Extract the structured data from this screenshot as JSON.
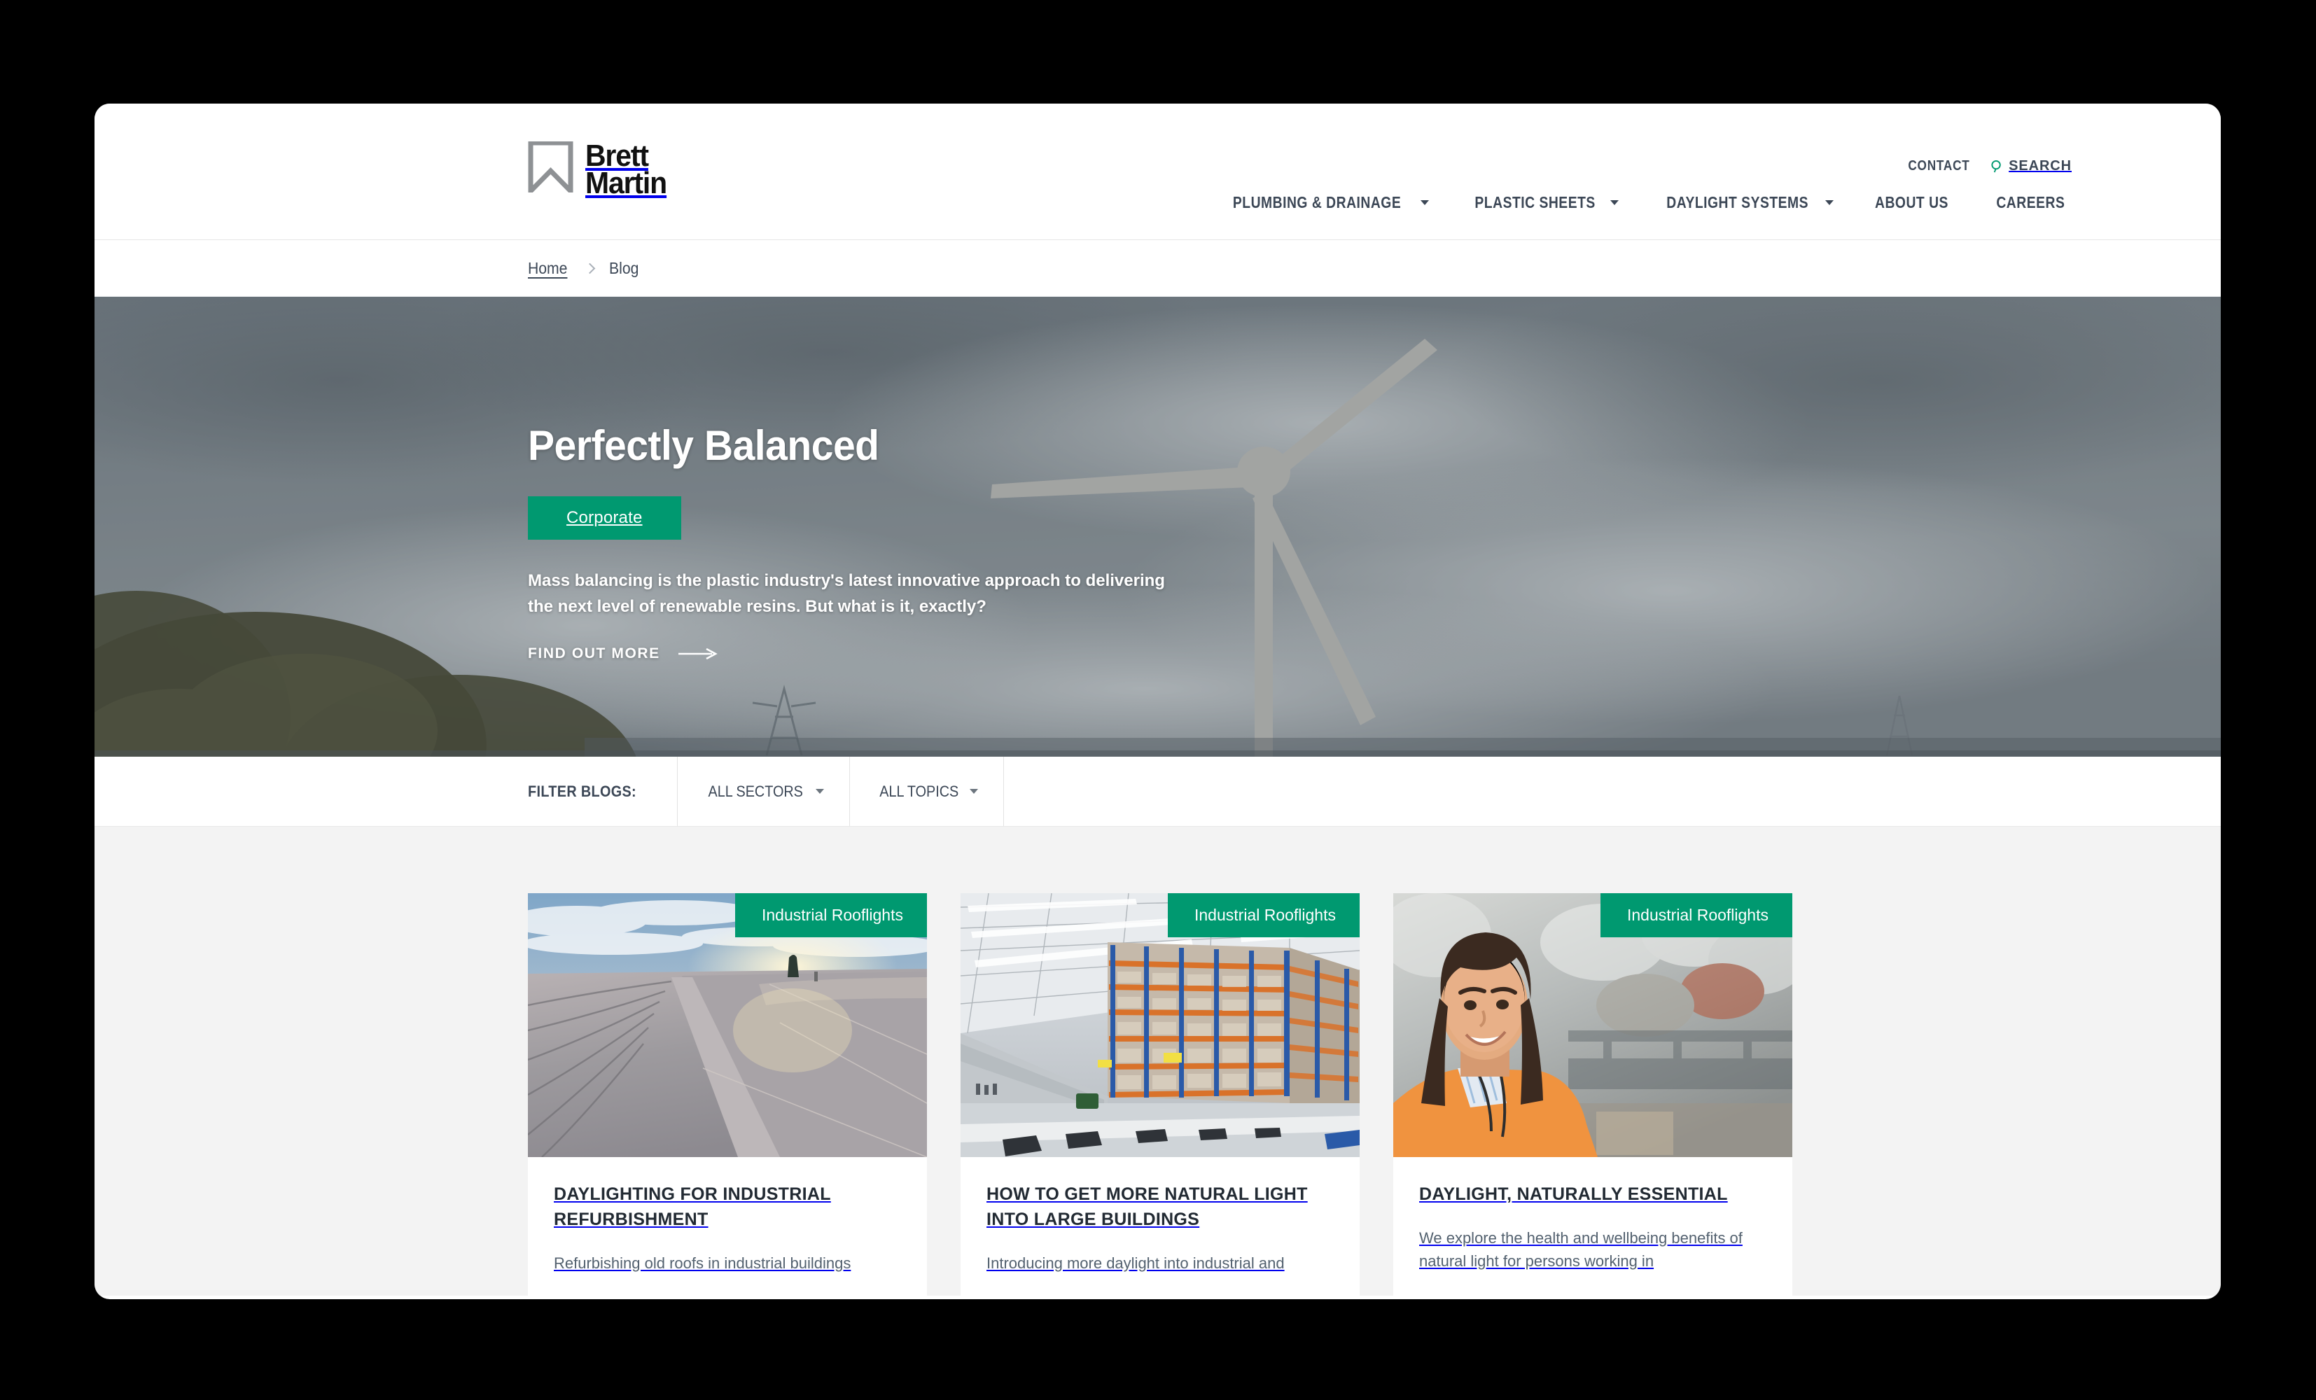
{
  "header": {
    "logo": {
      "name": "Brett\nMartin",
      "icon": "bookmark-logo-icon"
    },
    "utility": [
      {
        "label": "CONTACT",
        "icon": null
      },
      {
        "label": "SEARCH",
        "icon": "search-icon"
      }
    ],
    "nav": [
      {
        "label": "PLUMBING & DRAINAGE",
        "has_dropdown": true
      },
      {
        "label": "PLASTIC SHEETS",
        "has_dropdown": true
      },
      {
        "label": "DAYLIGHT SYSTEMS",
        "has_dropdown": true
      },
      {
        "label": "ABOUT US",
        "has_dropdown": false
      },
      {
        "label": "CAREERS",
        "has_dropdown": false
      }
    ]
  },
  "breadcrumb": {
    "home": "Home",
    "current": "Blog"
  },
  "hero": {
    "title": "Perfectly Balanced",
    "badge": "Corporate",
    "description": "Mass balancing is the plastic industry's latest innovative approach to delivering the next level of renewable resins. But what is it, exactly?",
    "cta": "FIND OUT MORE",
    "image_alt": "wind-turbine-cloudy-sky"
  },
  "filters": {
    "label": "FILTER BLOGS:",
    "dropdowns": [
      {
        "label": "ALL SECTORS"
      },
      {
        "label": "ALL TOPICS"
      }
    ]
  },
  "cards": [
    {
      "tag": "Industrial Rooflights",
      "title": "DAYLIGHTING FOR INDUSTRIAL REFURBISHMENT",
      "excerpt": "Refurbishing old roofs in industrial buildings",
      "image_alt": "industrial-roof-with-curved-rooflights-at-sunset"
    },
    {
      "tag": "Industrial Rooflights",
      "title": "HOW TO GET MORE NATURAL LIGHT INTO LARGE BUILDINGS",
      "excerpt": "Introducing more daylight into industrial and",
      "image_alt": "warehouse-interior-with-racking"
    },
    {
      "tag": "Industrial Rooflights",
      "title": "DAYLIGHT, NATURALLY ESSENTIAL",
      "excerpt": "We explore the health and wellbeing benefits of natural light for persons working in",
      "image_alt": "smiling-woman-in-orange-jacket-warehouse"
    }
  ],
  "colors": {
    "brand_green": "#009970",
    "text_dark": "#3c4756",
    "section_bg": "#f3f3f3"
  }
}
